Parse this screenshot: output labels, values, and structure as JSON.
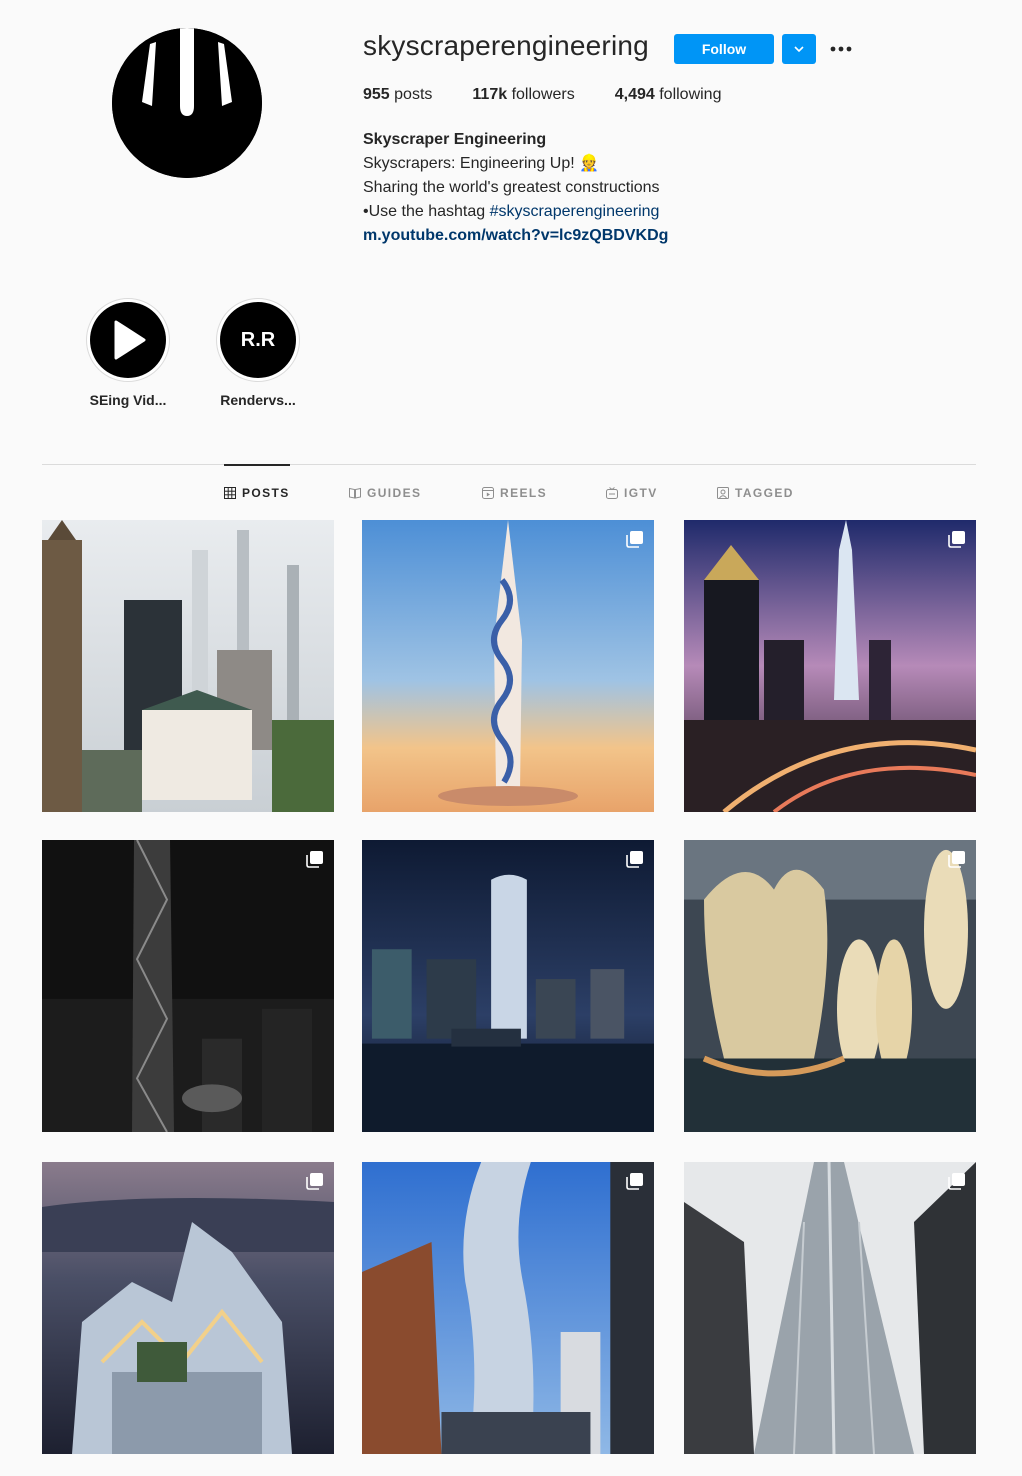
{
  "profile": {
    "username": "skyscraperengineering",
    "follow_label": "Follow",
    "stats": {
      "posts_count": "955",
      "posts_label": "posts",
      "followers_count": "117k",
      "followers_label": "followers",
      "following_count": "4,494",
      "following_label": "following"
    },
    "bio": {
      "full_name": "Skyscraper Engineering",
      "line1": "Skyscrapers: Engineering Up! 👷",
      "line2": "Sharing the world's greatest constructions",
      "line3_prefix": "•Use the hashtag ",
      "hashtag": "#skyscraperengineering",
      "website": "m.youtube.com/watch?v=lc9zQBDVKDg"
    }
  },
  "highlights": [
    {
      "label": "SEing Vid...",
      "icon": "play-icon"
    },
    {
      "label": "Rendervs...",
      "icon_text": "R.R"
    }
  ],
  "tabs": [
    {
      "label": "POSTS",
      "icon": "grid-icon",
      "active": true
    },
    {
      "label": "GUIDES",
      "icon": "guide-icon",
      "active": false
    },
    {
      "label": "REELS",
      "icon": "reels-icon",
      "active": false
    },
    {
      "label": "IGTV",
      "icon": "igtv-icon",
      "active": false
    },
    {
      "label": "TAGGED",
      "icon": "tagged-icon",
      "active": false
    }
  ],
  "colors": {
    "accent": "#0095f6",
    "link": "#00376b",
    "background": "#fafafa"
  }
}
